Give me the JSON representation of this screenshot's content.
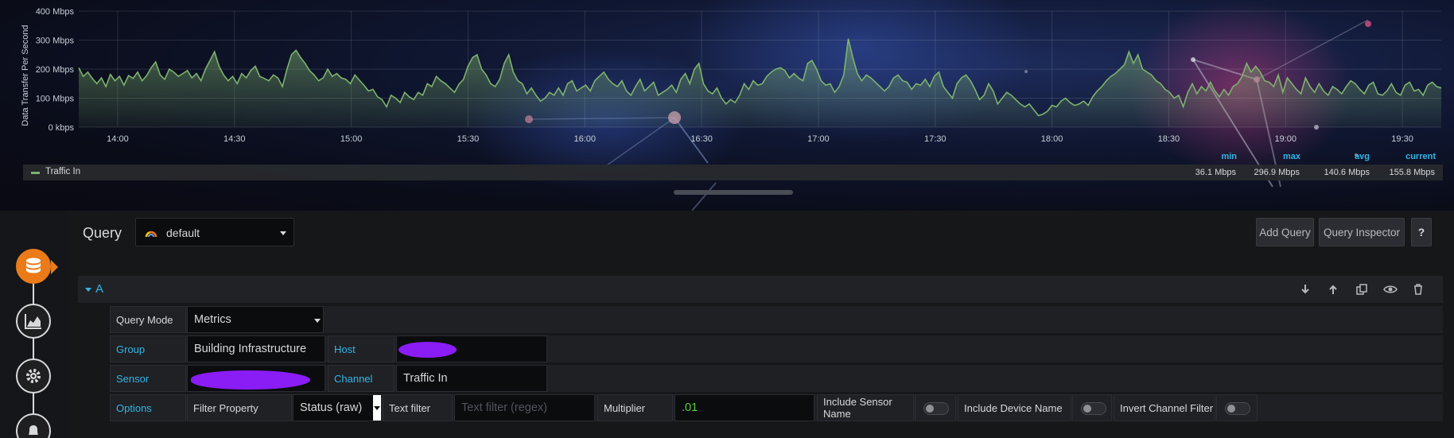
{
  "chart_data": {
    "type": "area",
    "ylabel": "Data Transfer Per Second",
    "y_ticks": [
      "0 kbps",
      "100 Mbps",
      "200 Mbps",
      "300 Mbps",
      "400 Mbps"
    ],
    "ylim": [
      0,
      400
    ],
    "y_unit": "Mbps",
    "x_range": [
      "13:50",
      "19:40"
    ],
    "x_ticks": [
      "14:00",
      "14:30",
      "15:00",
      "15:30",
      "16:00",
      "16:30",
      "17:00",
      "17:30",
      "18:00",
      "18:30",
      "19:00",
      "19:30"
    ],
    "grid": true,
    "legend_placement": "bottom",
    "series": [
      {
        "name": "Traffic In",
        "color": "#7eb26d",
        "values": [
          205,
          175,
          190,
          168,
          150,
          170,
          140,
          182,
          160,
          175,
          145,
          178,
          168,
          190,
          160,
          178,
          205,
          225,
          180,
          165,
          200,
          190,
          175,
          185,
          195,
          170,
          185,
          160,
          200,
          230,
          260,
          210,
          180,
          160,
          175,
          150,
          185,
          170,
          195,
          210,
          175,
          168,
          160,
          180,
          170,
          140,
          200,
          250,
          265,
          240,
          220,
          195,
          180,
          160,
          170,
          200,
          175,
          185,
          170,
          165,
          150,
          180,
          162,
          145,
          125,
          130,
          105,
          95,
          70,
          110,
          100,
          85,
          120,
          105,
          95,
          120,
          110,
          150,
          140,
          175,
          160,
          150,
          135,
          120,
          148,
          165,
          210,
          240,
          250,
          200,
          180,
          150,
          140,
          165,
          220,
          250,
          190,
          160,
          150,
          115,
          135,
          110,
          90,
          100,
          120,
          110,
          135,
          110,
          150,
          160,
          125,
          135,
          145,
          125,
          160,
          175,
          190,
          165,
          150,
          140,
          160,
          125,
          110,
          140,
          165,
          125,
          140,
          155,
          110,
          120,
          130,
          145,
          120,
          165,
          185,
          150,
          200,
          220,
          150,
          125,
          115,
          135,
          100,
          80,
          95,
          85,
          110,
          150,
          130,
          160,
          145,
          150,
          175,
          190,
          200,
          205,
          195,
          170,
          185,
          170,
          160,
          220,
          230,
          200,
          160,
          145,
          150,
          120,
          140,
          180,
          305,
          240,
          185,
          160,
          180,
          170,
          155,
          140,
          125,
          140,
          170,
          180,
          160,
          155,
          130,
          150,
          145,
          165,
          140,
          175,
          190,
          140,
          120,
          100,
          150,
          170,
          180,
          160,
          130,
          95,
          110,
          150,
          125,
          80,
          100,
          120,
          110,
          95,
          80,
          70,
          80,
          60,
          40,
          45,
          55,
          75,
          70,
          90,
          100,
          85,
          75,
          80,
          90,
          75,
          105,
          125,
          140,
          160,
          175,
          185,
          200,
          215,
          260,
          220,
          250,
          200,
          190,
          180,
          160,
          150,
          130,
          120,
          100,
          110,
          70,
          120,
          150,
          115,
          140,
          125,
          155,
          125,
          105,
          130,
          110,
          140,
          150,
          175,
          220,
          190,
          210,
          190,
          160,
          155,
          140,
          180,
          120,
          170,
          150,
          130,
          115,
          170,
          140,
          120,
          150,
          125,
          110,
          140,
          130,
          115,
          140,
          160,
          150,
          130,
          115,
          145,
          155,
          115,
          110,
          125,
          150,
          120,
          110,
          145,
          155,
          125,
          130,
          110,
          145,
          155,
          140,
          135
        ]
      }
    ],
    "legend": {
      "headers": [
        "min",
        "max",
        "avg",
        "current"
      ],
      "values": [
        "36.1 Mbps",
        "296.9 Mbps",
        "140.6 Mbps",
        "155.8 Mbps"
      ]
    }
  },
  "query": {
    "title": "Query",
    "datasource": "default",
    "add_query_label": "Add Query",
    "inspector_label": "Query Inspector",
    "help_label": "?",
    "row_letter": "A",
    "query_mode_label": "Query Mode",
    "query_mode_value": "Metrics",
    "group_label": "Group",
    "group_value": "Building Infrastructure",
    "host_label": "Host",
    "sensor_label": "Sensor",
    "channel_label": "Channel",
    "channel_value": "Traffic In",
    "options_label": "Options",
    "filter_property_label": "Filter Property",
    "filter_property_value": "Status (raw)",
    "text_filter_label": "Text filter",
    "text_filter_placeholder": "Text filter (regex)",
    "multiplier_label": "Multiplier",
    "multiplier_value": ".01",
    "include_sensor_label": "Include Sensor Name",
    "include_device_label": "Include Device Name",
    "invert_channel_label": "Invert Channel Filter"
  },
  "icons": {
    "rail": [
      "database-icon",
      "chart-area-icon",
      "settings-icon",
      "bell-icon"
    ],
    "row_actions": [
      "arrow-down-icon",
      "arrow-up-icon",
      "duplicate-icon",
      "eye-icon",
      "trash-icon"
    ]
  },
  "colors": {
    "series": "#7eb26d",
    "accent_orange": "#eb7b18",
    "label_blue": "#33b5e5",
    "value_green": "#5ad140",
    "redaction": "#8a1cf5"
  }
}
